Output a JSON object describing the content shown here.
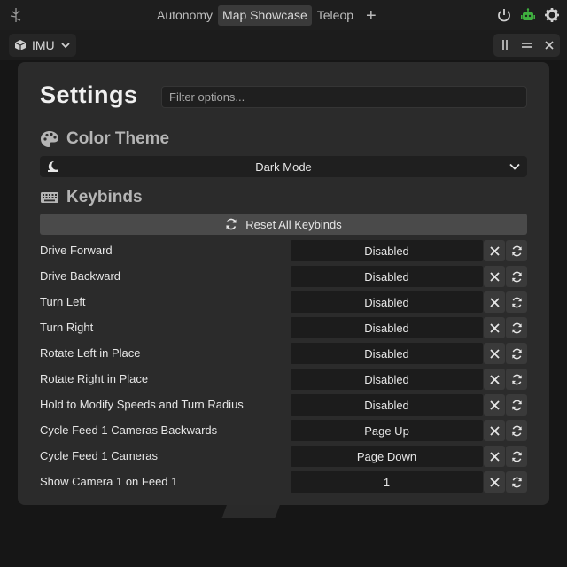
{
  "topbar": {
    "tabs": [
      {
        "label": "Autonomy",
        "active": false
      },
      {
        "label": "Map Showcase",
        "active": true
      },
      {
        "label": "Teleop",
        "active": false
      }
    ],
    "add_tab_label": "+",
    "icons": [
      "power-icon",
      "robot-icon",
      "gear-icon"
    ]
  },
  "subbar": {
    "widget_label": "IMU",
    "controls": [
      "columns-icon",
      "rows-icon",
      "close-icon"
    ]
  },
  "settings": {
    "title": "Settings",
    "filter_placeholder": "Filter options...",
    "color_theme": {
      "heading": "Color Theme",
      "selected": "Dark Mode"
    },
    "keybinds": {
      "heading": "Keybinds",
      "reset_all_label": "Reset All Keybinds",
      "items": [
        {
          "label": "Drive Forward",
          "value": "Disabled"
        },
        {
          "label": "Drive Backward",
          "value": "Disabled"
        },
        {
          "label": "Turn Left",
          "value": "Disabled"
        },
        {
          "label": "Turn Right",
          "value": "Disabled"
        },
        {
          "label": "Rotate Left in Place",
          "value": "Disabled"
        },
        {
          "label": "Rotate Right in Place",
          "value": "Disabled"
        },
        {
          "label": "Hold to Modify Speeds and Turn Radius",
          "value": "Disabled"
        },
        {
          "label": "Cycle Feed 1 Cameras Backwards",
          "value": "Page Up"
        },
        {
          "label": "Cycle Feed 1 Cameras",
          "value": "Page Down"
        },
        {
          "label": "Show Camera 1 on Feed 1",
          "value": "1"
        }
      ]
    }
  },
  "colors": {
    "background": "#161616",
    "panel": "#2b2b2b",
    "accent_green": "#3fae3f"
  }
}
